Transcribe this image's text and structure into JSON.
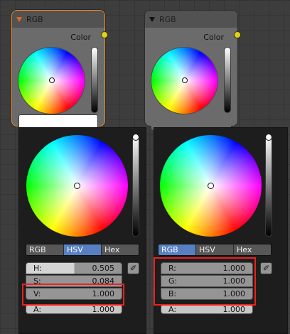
{
  "nodes": [
    {
      "title": "RGB",
      "socket_label": "Color",
      "selected": true
    },
    {
      "title": "RGB",
      "socket_label": "Color",
      "selected": false
    }
  ],
  "pickers": [
    {
      "tabs": [
        "RGB",
        "HSV",
        "Hex"
      ],
      "active_tab": "HSV",
      "fields": [
        {
          "label": "H:",
          "value": "0.505"
        },
        {
          "label": "S:",
          "value": "0.084"
        },
        {
          "label": "V:",
          "value": "1.000"
        }
      ],
      "alpha": {
        "label": "A:",
        "value": "1.000"
      }
    },
    {
      "tabs": [
        "RGB",
        "HSV",
        "Hex"
      ],
      "active_tab": "RGB",
      "fields": [
        {
          "label": "R:",
          "value": "1.000"
        },
        {
          "label": "G:",
          "value": "1.000"
        },
        {
          "label": "B:",
          "value": "1.000"
        }
      ],
      "alpha": {
        "label": "A:",
        "value": "1.000"
      }
    }
  ],
  "colors": {
    "selected_outline": "#ec8b2a",
    "active_tab": "#5680c2",
    "highlight_box": "#ee1f1f",
    "socket": "#dbd320"
  },
  "icons": [
    "collapse-arrow-icon",
    "eyedropper-icon"
  ]
}
